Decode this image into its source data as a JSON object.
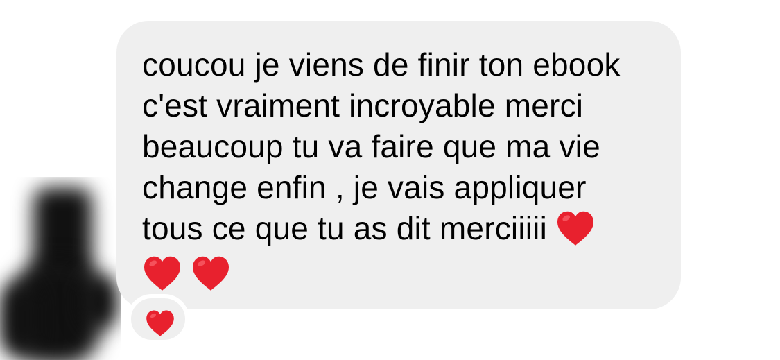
{
  "conversation": {
    "avatar": {
      "icon": "blurred-profile-photo",
      "color": "#111111"
    },
    "message": {
      "lines": [
        "coucou je viens de finir ton ebook",
        "c'est vraiment incroyable merci",
        "beaucoup tu va faire que ma vie",
        "change enfin , je vais appliquer",
        "tous ce que tu as dit merciiiii"
      ],
      "emoji": [
        "heart-icon",
        "heart-icon",
        "heart-icon"
      ],
      "bubble_color": "#efefef",
      "text_color": "#000000"
    },
    "reaction": {
      "emoji": "heart-icon",
      "heart_color": "#e8212e"
    }
  }
}
